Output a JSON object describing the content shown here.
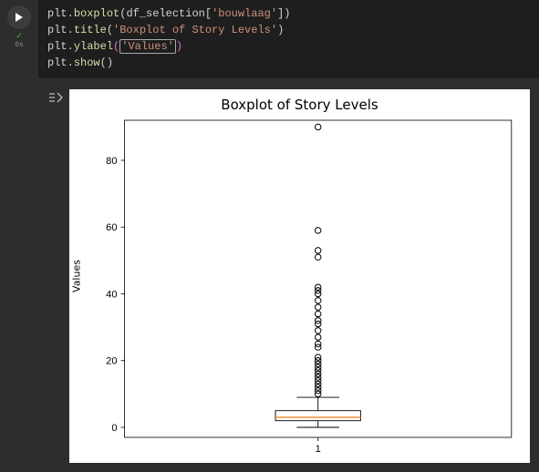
{
  "gutter": {
    "exec_status": "✓",
    "exec_time": "0s"
  },
  "code": {
    "lines": [
      [
        {
          "cls": "t-obj",
          "txt": "plt"
        },
        {
          "cls": "t-punc",
          "txt": "."
        },
        {
          "cls": "t-method",
          "txt": "boxplot"
        },
        {
          "cls": "t-punc",
          "txt": "("
        },
        {
          "cls": "t-obj",
          "txt": "df_selection"
        },
        {
          "cls": "t-punc",
          "txt": "["
        },
        {
          "cls": "t-str",
          "txt": "'bouwlaag'"
        },
        {
          "cls": "t-punc",
          "txt": "])"
        }
      ],
      [
        {
          "cls": "t-obj",
          "txt": "plt"
        },
        {
          "cls": "t-punc",
          "txt": "."
        },
        {
          "cls": "t-method",
          "txt": "title"
        },
        {
          "cls": "t-punc",
          "txt": "("
        },
        {
          "cls": "t-str",
          "txt": "'Boxplot of Story Levels'"
        },
        {
          "cls": "t-punc",
          "txt": ")"
        }
      ],
      [
        {
          "cls": "t-obj",
          "txt": "plt"
        },
        {
          "cls": "t-punc",
          "txt": "."
        },
        {
          "cls": "t-method",
          "txt": "ylabel"
        },
        {
          "cls": "t-str-b",
          "txt": "("
        },
        {
          "cls": "t-str",
          "txt": "'Values'",
          "cursor": true
        },
        {
          "cls": "t-str-b",
          "txt": ")"
        }
      ],
      [
        {
          "cls": "t-obj",
          "txt": "plt"
        },
        {
          "cls": "t-punc",
          "txt": "."
        },
        {
          "cls": "t-method",
          "txt": "show"
        },
        {
          "cls": "t-punc",
          "txt": "()"
        }
      ]
    ]
  },
  "chart_data": {
    "type": "boxplot",
    "title": "Boxplot of Story Levels",
    "ylabel": "Values",
    "xlabel": "",
    "xticks": [
      "1"
    ],
    "yticks": [
      0,
      20,
      40,
      60,
      80
    ],
    "ylim": [
      -3,
      92
    ],
    "box": {
      "q1": 2,
      "median": 3,
      "q3": 5,
      "whisker_low": 0,
      "whisker_high": 9
    },
    "outliers": [
      10,
      11,
      12,
      13,
      14,
      15,
      16,
      17,
      18,
      19,
      20,
      21,
      24,
      25,
      27,
      29,
      31,
      32,
      34,
      36,
      38,
      40,
      41,
      42,
      51,
      53,
      59,
      90
    ],
    "colors": {
      "median": "#ff7f0e",
      "box": "#000000"
    }
  }
}
